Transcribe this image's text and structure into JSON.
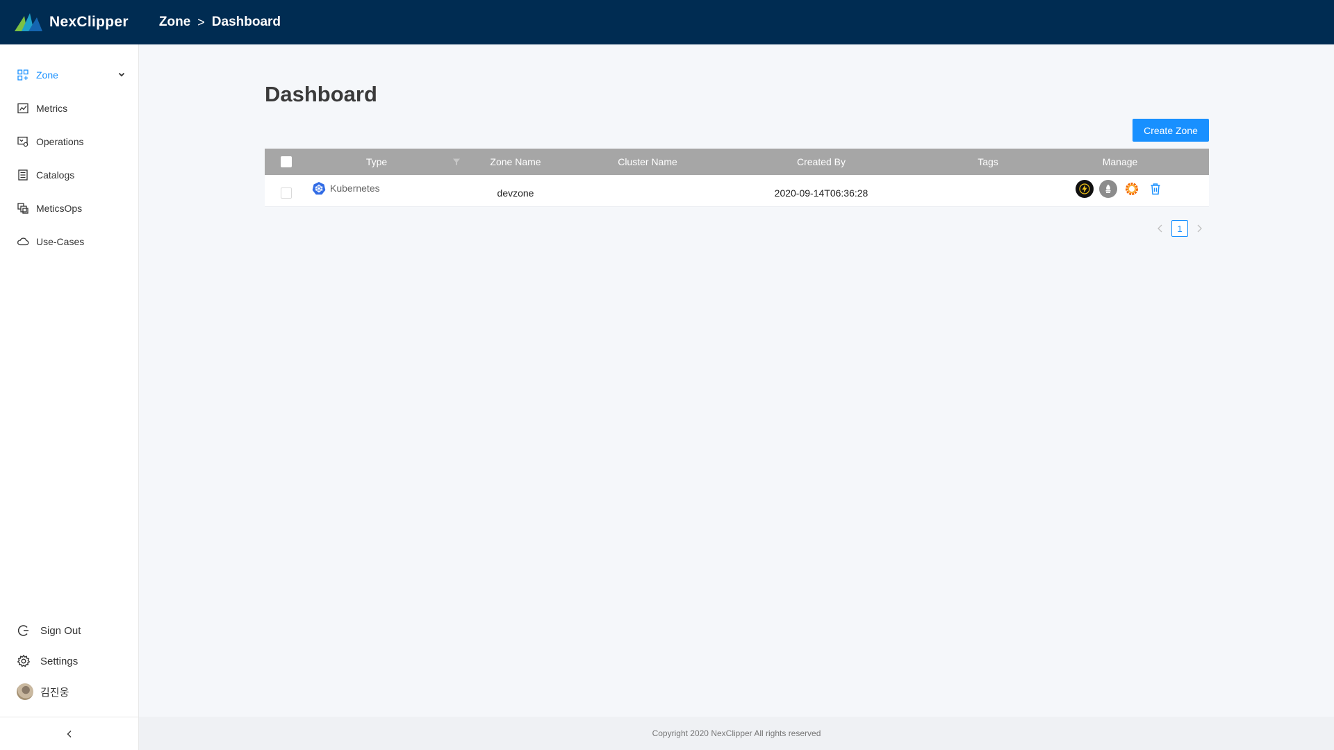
{
  "header": {
    "brand": "NexClipper",
    "breadcrumb": [
      "Zone",
      ">",
      "Dashboard"
    ]
  },
  "sidebar": {
    "items": [
      {
        "label": "Zone",
        "icon": "zone-icon",
        "active": true
      },
      {
        "label": "Metrics",
        "icon": "metrics-icon"
      },
      {
        "label": "Operations",
        "icon": "operations-icon"
      },
      {
        "label": "Catalogs",
        "icon": "catalogs-icon"
      },
      {
        "label": "MeticsOps",
        "icon": "meticsops-icon"
      },
      {
        "label": "Use-Cases",
        "icon": "cloud-icon"
      }
    ],
    "bottom": {
      "sign_out": "Sign Out",
      "settings": "Settings",
      "user_name": "김진웅"
    }
  },
  "main": {
    "title": "Dashboard",
    "create_button": "Create Zone",
    "table": {
      "columns": [
        "Type",
        "Zone Name",
        "Cluster Name",
        "Created By",
        "Tags",
        "Manage"
      ],
      "rows": [
        {
          "type": "Kubernetes",
          "zone_name": "devzone",
          "cluster_name": "",
          "created_by": "2020-09-14T06:36:28",
          "tags": "",
          "manage_icons": [
            "bolt-icon",
            "prometheus-icon",
            "grafana-icon",
            "trash-icon"
          ]
        }
      ]
    },
    "pagination": {
      "current": "1"
    }
  },
  "footer": {
    "copyright": "Copyright 2020 NexClipper All rights reserved"
  },
  "colors": {
    "header_bg": "#002c52",
    "accent": "#1890ff",
    "table_header_bg": "#a6a6a6"
  }
}
